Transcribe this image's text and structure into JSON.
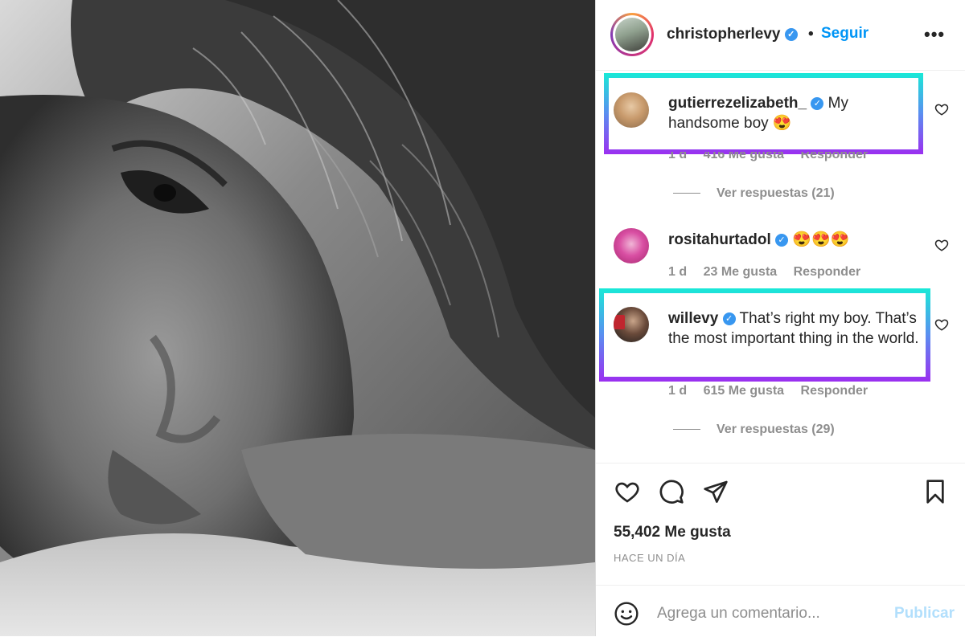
{
  "post": {
    "author": "christopherlevy",
    "follow_label": "Seguir",
    "more_label": "•••",
    "separator": "•"
  },
  "comments": [
    {
      "user": "gutierrezelizabeth_",
      "text": "My handsome boy 😍",
      "age": "1 d",
      "likes": "416 Me gusta",
      "reply": "Responder",
      "view_replies": "Ver respuestas (21)",
      "highlighted": true
    },
    {
      "user": "rositahurtadol",
      "text": "😍😍😍",
      "age": "1 d",
      "likes": "23 Me gusta",
      "reply": "Responder",
      "highlighted": false
    },
    {
      "user": "willevy",
      "text": "That’s right my boy. That’s the most important thing in the world.",
      "age": "1 d",
      "likes": "615 Me gusta",
      "reply": "Responder",
      "view_replies": "Ver respuestas (29)",
      "highlighted": true
    }
  ],
  "stats": {
    "likes": "55,402 Me gusta",
    "time": "HACE UN DÍA"
  },
  "composer": {
    "placeholder": "Agrega un comentario...",
    "publish_label": "Publicar"
  },
  "icons": {
    "like": "heart-icon",
    "comment": "comment-icon",
    "share": "send-icon",
    "save": "bookmark-icon",
    "emoji": "emoji-icon"
  },
  "colors": {
    "follow": "#0095f6",
    "verified": "#3897f0",
    "highlight_top": "#19e9d7",
    "highlight_bottom": "#9b2ff0",
    "publish_disabled": "#b2dffc"
  }
}
